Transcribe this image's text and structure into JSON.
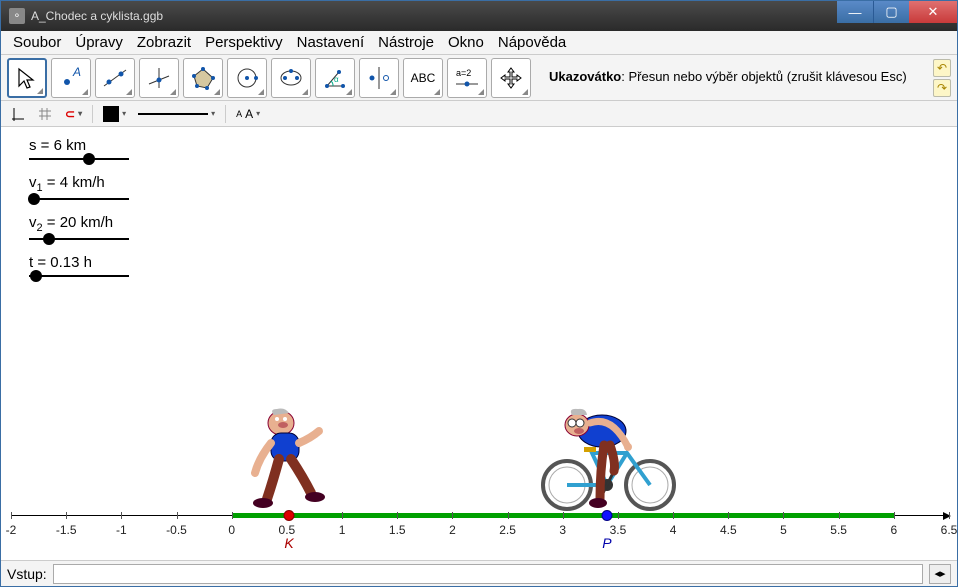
{
  "titlebar": {
    "title": "A_Chodec a cyklista.ggb"
  },
  "menu": {
    "items": [
      "Soubor",
      "Úpravy",
      "Zobrazit",
      "Perspektivy",
      "Nastavení",
      "Nástroje",
      "Okno",
      "Nápověda"
    ]
  },
  "help": {
    "title": "Ukazovátko",
    "text": ": Přesun nebo výběr objektů (zrušit klávesou Esc)"
  },
  "stylebar": {
    "aa": "A A"
  },
  "sliders": {
    "s": {
      "label": "s = 6 km",
      "pos": 60
    },
    "v1": {
      "label_pre": "v",
      "label_sub": "1",
      "label_post": " = 4 km/h",
      "pos": 5
    },
    "v2": {
      "label_pre": "v",
      "label_sub": "2",
      "label_post": " = 20 km/h",
      "pos": 20
    },
    "t": {
      "label": "t = 0.13 h",
      "pos": 7
    }
  },
  "axis": {
    "min": -2,
    "max": 6.5,
    "step": 0.5,
    "ticks": [
      "-2",
      "-1.5",
      "-1",
      "-0.5",
      "0",
      "0.5",
      "1",
      "1.5",
      "2",
      "2.5",
      "3",
      "3.5",
      "4",
      "4.5",
      "5",
      "5.5",
      "6",
      "6.5"
    ],
    "green_from": 0,
    "green_to": 6,
    "K": {
      "x": 0.52,
      "label": "K"
    },
    "P": {
      "x": 3.4,
      "label": "P"
    }
  },
  "characters": {
    "pedestrian_x": 0.52,
    "cyclist_x": 3.4
  },
  "inputbar": {
    "label": "Vstup:",
    "value": ""
  }
}
